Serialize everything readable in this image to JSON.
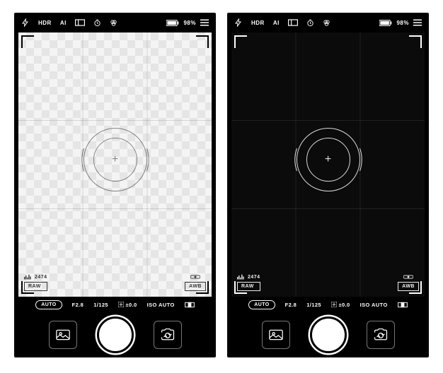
{
  "topbar": {
    "hdr": "HDR",
    "ai": "AI",
    "battery_percent": "98%"
  },
  "viewfinder": {
    "histogram_label": "2474",
    "raw_badge": "RAW",
    "awb_badge": "AWB"
  },
  "settings": {
    "auto_pill": "AUTO",
    "aperture": "F2.8",
    "shutter": "1/125",
    "ev": "±0.0",
    "iso": "ISO AUTO"
  },
  "icons": {
    "flash": "flash-icon",
    "timer": "timer-icon",
    "ratio": "aspect-ratio-icon",
    "filter": "filter-icon",
    "battery": "battery-icon",
    "menu": "menu-icon",
    "histogram": "histogram-icon",
    "level": "level-icon",
    "gallery": "gallery-icon",
    "switch": "switch-camera-icon",
    "ev_icon": "exposure-compensation-icon"
  }
}
